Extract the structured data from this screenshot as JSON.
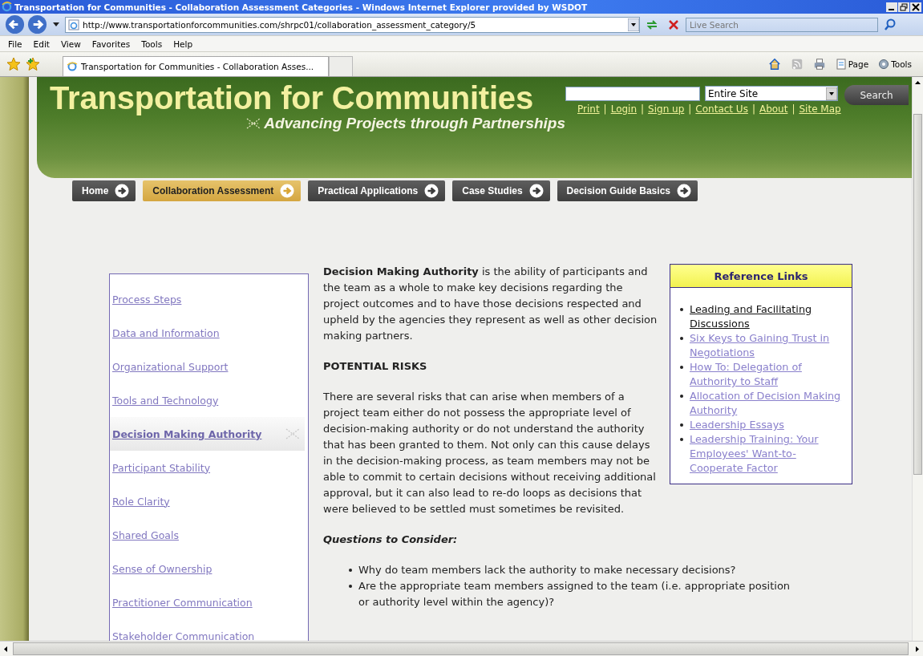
{
  "window": {
    "title": "Transportation for Communities - Collaboration Assessment Categories - Windows Internet Explorer provided by WSDOT"
  },
  "browser": {
    "address": "http://www.transportationforcommunities.com/shrpc01/collaboration_assessment_category/5",
    "search_placeholder": "Live Search",
    "menu": [
      "File",
      "Edit",
      "View",
      "Favorites",
      "Tools",
      "Help"
    ],
    "tab_title": "Transportation for Communities - Collaboration Asses...",
    "tools": [
      "Page",
      "Tools"
    ]
  },
  "site": {
    "title": "Transportation for Communities",
    "tagline": "Advancing Projects through Partnerships",
    "search": {
      "scope": "Entire Site",
      "button": "Search"
    },
    "header_links": [
      {
        "kind": "link",
        "text": "Print"
      },
      {
        "kind": "separator",
        "text": "|"
      },
      {
        "kind": "link",
        "text": "Login"
      },
      {
        "kind": "separator",
        "text": "|"
      },
      {
        "kind": "link",
        "text": "Sign up"
      },
      {
        "kind": "separator",
        "text": "|"
      },
      {
        "kind": "link",
        "text": "Contact Us"
      },
      {
        "kind": "separator",
        "text": "|"
      },
      {
        "kind": "link",
        "text": "About"
      },
      {
        "kind": "separator",
        "text": "|"
      },
      {
        "kind": "link",
        "text": "Site Map"
      }
    ],
    "nav": [
      {
        "label": "Home",
        "selected": false
      },
      {
        "label": "Collaboration Assessment",
        "selected": true
      },
      {
        "label": "Practical Applications",
        "selected": false
      },
      {
        "label": "Case Studies",
        "selected": false
      },
      {
        "label": "Decision Guide Basics",
        "selected": false
      }
    ]
  },
  "sidebar": {
    "items": [
      {
        "label": "Process Steps",
        "selected": false
      },
      {
        "label": "Data and Information",
        "selected": false
      },
      {
        "label": "Organizational Support",
        "selected": false
      },
      {
        "label": "Tools and Technology",
        "selected": false
      },
      {
        "label": "Decision Making Authority",
        "selected": true
      },
      {
        "label": "Participant Stability",
        "selected": false
      },
      {
        "label": "Role Clarity",
        "selected": false
      },
      {
        "label": "Shared Goals",
        "selected": false
      },
      {
        "label": "Sense of Ownership",
        "selected": false
      },
      {
        "label": "Practitioner Communication",
        "selected": false
      },
      {
        "label": "Stakeholder Communication",
        "selected": false
      }
    ]
  },
  "article": {
    "intro": "**Decision Making Authority** is the ability of participants and the team as a whole to make key decisions regarding the project outcomes and to have those decisions respected and upheld by the agencies they represent as well as other decision making partners.",
    "heading": "POTENTIAL RISKS",
    "paragraph": "There are several risks that can arise when members of a project team either do not possess the appropriate level of decision-making authority or do not understand the authority that has been granted to them. Not only can this cause delays in the decision-making process, as team members may not be able to commit to certain decisions without receiving additional approval, but it can also lead to re-do loops as decisions that were believed to be settled must sometimes be revisited.",
    "questions_heading": "Questions to Consider:",
    "questions": [
      "Why do team members lack the authority to make necessary decisions?",
      "Are the appropriate team members assigned to the team (i.e. appropriate position or authority level within the agency)?"
    ]
  },
  "reference": {
    "title": "Reference Links",
    "links": [
      {
        "label": "Leading and Facilitating Discussions",
        "visited": false
      },
      {
        "label": "Six Keys to Gaining Trust in Negotiations",
        "visited": true
      },
      {
        "label": "How To: Delegation of Authority to Staff",
        "visited": true
      },
      {
        "label": "Allocation of Decision Making Authority",
        "visited": true
      },
      {
        "label": "Leadership Essays",
        "visited": true
      },
      {
        "label": "Leadership Training: Your Employees' Want-to-Cooperate Factor",
        "visited": true
      }
    ]
  }
}
